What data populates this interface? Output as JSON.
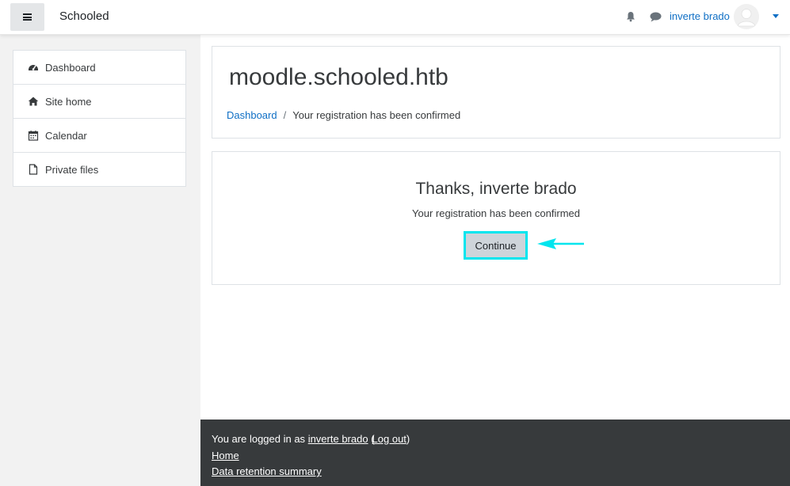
{
  "navbar": {
    "brand": "Schooled",
    "user_name": "inverte brado",
    "icons": [
      "menu-icon",
      "bell-icon",
      "chat-icon",
      "avatar-icon",
      "caret-down-icon"
    ]
  },
  "sidebar": {
    "items": [
      {
        "label": "Dashboard",
        "icon": "dashboard-icon"
      },
      {
        "label": "Site home",
        "icon": "home-icon"
      },
      {
        "label": "Calendar",
        "icon": "calendar-icon"
      },
      {
        "label": "Private files",
        "icon": "file-icon"
      }
    ]
  },
  "header": {
    "title": "moodle.schooled.htb",
    "breadcrumb": {
      "home": "Dashboard",
      "separator": "/",
      "current": "Your registration has been confirmed"
    }
  },
  "content": {
    "heading": "Thanks, inverte brado",
    "message": "Your registration has been confirmed",
    "continue_label": "Continue"
  },
  "footer": {
    "logged_in_prefix": "You are logged in as",
    "user_name": "inverte brado",
    "open_paren": "(",
    "logout_label": "Log out",
    "close_paren": ")",
    "home_label": "Home",
    "data_retention_label": "Data retention summary"
  },
  "colors": {
    "link": "#0f6fc5",
    "highlight": "#00e5ee",
    "footer_bg": "#373a3c",
    "button_bg": "#ced4da"
  }
}
